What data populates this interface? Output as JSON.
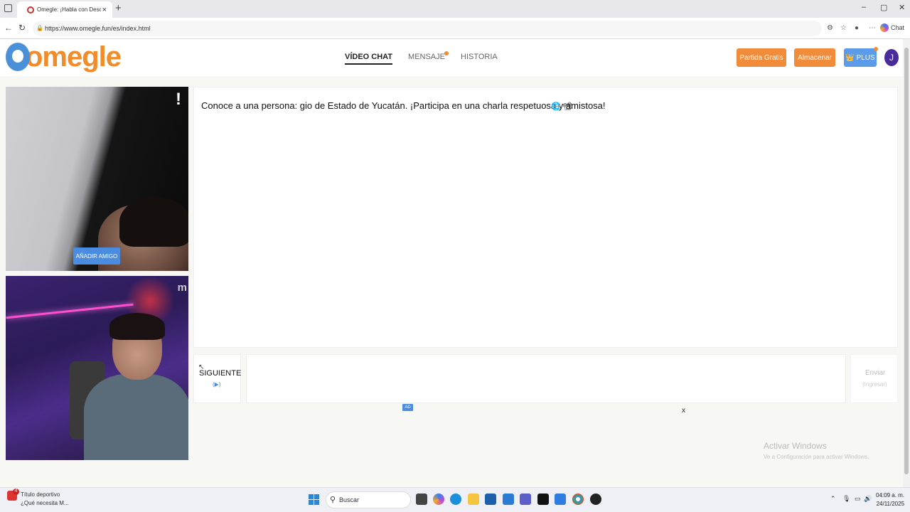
{
  "browser": {
    "tab_title": "Omegle: ¡Habla con Descon",
    "tab_close": "×",
    "new_tab": "+",
    "url": "https://www.omegle.fun/es/index.html",
    "copilot_label": "Chat",
    "window_controls": [
      "–",
      "▢",
      "✕"
    ]
  },
  "header": {
    "logo_text": "omegle",
    "nav": [
      {
        "label": "VÍDEO CHAT",
        "active": true
      },
      {
        "label": "MENSAJE",
        "badge": true
      },
      {
        "label": "HISTORIA"
      }
    ],
    "buttons": {
      "partida": "Partida Gratis",
      "almacenar": "Almacenar",
      "plus": "👑 PLUS"
    },
    "avatar_initial": "J"
  },
  "video": {
    "stranger_flag": "!",
    "add_friend": "AÑADIR AMIGO",
    "self_watermark": "m"
  },
  "chat": {
    "message": "Conoce a una persona: gio de Estado de Yucatán. ¡Participa en una charla respetuosa y amistosa!",
    "emoji1": "🌐",
    "emoji2": "📽"
  },
  "controls": {
    "next_label": "SIGUIENTE",
    "next_sub": "(▶)",
    "send_label": "Enviar",
    "send_sub": "(Ingresar)",
    "ad_badge": "AD",
    "ad_close": "x"
  },
  "watermark": {
    "line1": "Activar Windows",
    "line2": "Ve a Configuración para activar Windows."
  },
  "taskbar": {
    "news_count": "4",
    "news_title": "Título deportivo",
    "news_sub": "¿Qué necesita M...",
    "search_placeholder": "Buscar",
    "time": "04:09 a. m.",
    "date": "24/11/2025"
  },
  "colors": {
    "accent_orange": "#f08c3a",
    "accent_blue": "#5b9be8",
    "avatar_purple": "#4a2b9c"
  }
}
